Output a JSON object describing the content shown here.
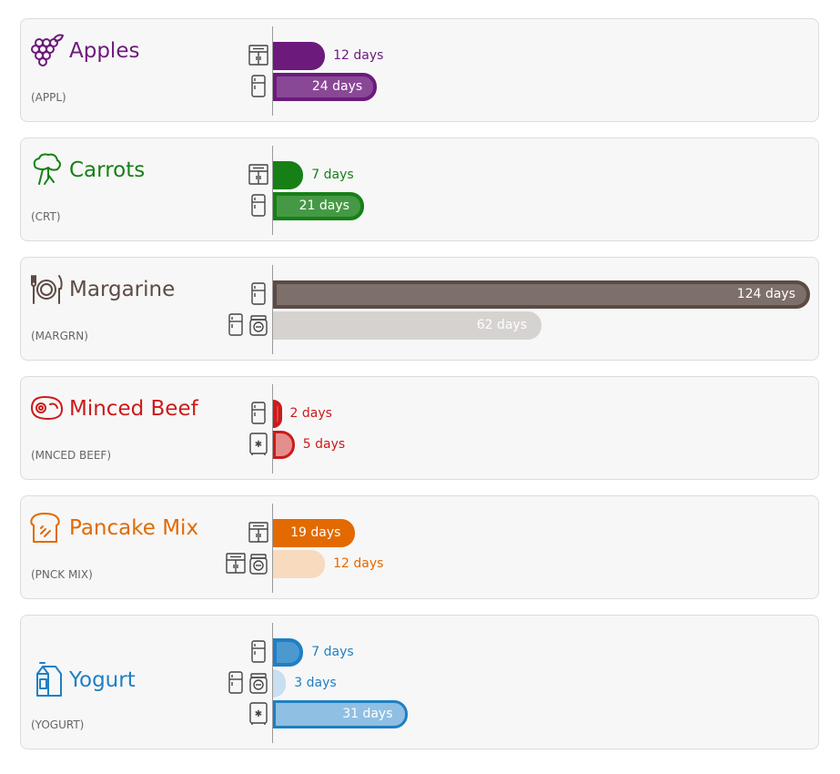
{
  "chart_data": {
    "type": "bar",
    "value_unit": "days",
    "items": [
      {
        "name": "Apples",
        "code": "(APPL)",
        "icon": "grapes-icon",
        "color": "#6c1a7c",
        "bars": [
          {
            "storage": [
              "pantry"
            ],
            "value": 12,
            "label": "12 days",
            "style": "solid"
          },
          {
            "storage": [
              "fridge"
            ],
            "value": 24,
            "label": "24 days",
            "style": "light-outlined"
          }
        ]
      },
      {
        "name": "Carrots",
        "code": "(CRT)",
        "icon": "broccoli-icon",
        "color": "#168016",
        "bars": [
          {
            "storage": [
              "pantry"
            ],
            "value": 7,
            "label": "7 days",
            "style": "solid"
          },
          {
            "storage": [
              "fridge"
            ],
            "value": 21,
            "label": "21 days",
            "style": "light-outlined"
          }
        ]
      },
      {
        "name": "Margarine",
        "code": "(MARGRN)",
        "icon": "plate-cutlery-icon",
        "color": "#5c4b44",
        "bars": [
          {
            "storage": [
              "fridge"
            ],
            "value": 124,
            "label": "124 days",
            "style": "light-outlined"
          },
          {
            "storage": [
              "fridge",
              "after-opening"
            ],
            "value": 62,
            "label": "62 days",
            "style": "pale"
          }
        ]
      },
      {
        "name": "Minced Beef",
        "code": "(MNCED BEEF)",
        "icon": "steak-icon",
        "color": "#cc1a1a",
        "bars": [
          {
            "storage": [
              "fridge"
            ],
            "value": 2,
            "label": "2 days",
            "style": "light-outlined"
          },
          {
            "storage": [
              "freezer"
            ],
            "value": 5,
            "label": "5 days",
            "style": "pale-outlined"
          }
        ]
      },
      {
        "name": "Pancake Mix",
        "code": "(PNCK MIX)",
        "icon": "bread-icon",
        "color": "#e26a00",
        "bars": [
          {
            "storage": [
              "pantry"
            ],
            "value": 19,
            "label": "19 days",
            "style": "solid"
          },
          {
            "storage": [
              "pantry",
              "after-opening"
            ],
            "value": 12,
            "label": "12 days",
            "style": "pale"
          }
        ]
      },
      {
        "name": "Yogurt",
        "code": "(YOGURT)",
        "icon": "milk-carton-icon",
        "color": "#1f7fc4",
        "bars": [
          {
            "storage": [
              "fridge"
            ],
            "value": 7,
            "label": "7 days",
            "style": "light-outlined"
          },
          {
            "storage": [
              "fridge",
              "after-opening"
            ],
            "value": 3,
            "label": "3 days",
            "style": "pale"
          },
          {
            "storage": [
              "freezer"
            ],
            "value": 31,
            "label": "31 days",
            "style": "pale-outlined"
          }
        ]
      }
    ]
  }
}
